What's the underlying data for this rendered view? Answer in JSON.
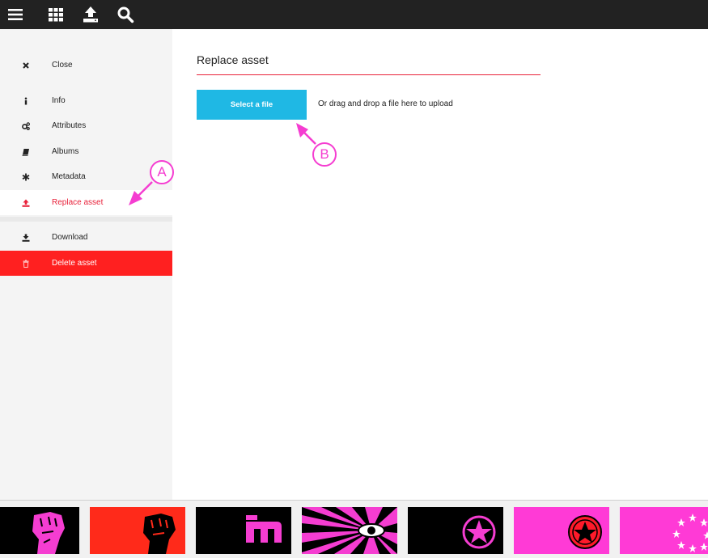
{
  "topbar": {
    "icons": [
      "menu-icon",
      "grid-icon",
      "upload-icon",
      "search-icon"
    ]
  },
  "sidebar": {
    "items": [
      {
        "id": "close",
        "label": "Close",
        "icon": "close-icon"
      },
      {
        "id": "info",
        "label": "Info",
        "icon": "info-icon"
      },
      {
        "id": "attributes",
        "label": "Attributes",
        "icon": "gears-icon"
      },
      {
        "id": "albums",
        "label": "Albums",
        "icon": "book-icon"
      },
      {
        "id": "metadata",
        "label": "Metadata",
        "icon": "asterisk-icon"
      },
      {
        "id": "replace",
        "label": "Replace asset",
        "icon": "upload-icon",
        "active": true
      },
      {
        "id": "download",
        "label": "Download",
        "icon": "download-icon"
      },
      {
        "id": "delete",
        "label": "Delete asset",
        "icon": "trash-icon",
        "danger": true
      }
    ]
  },
  "panel": {
    "title": "Replace asset",
    "select_label": "Select a file",
    "drop_hint": "Or drag and drop a file here to upload"
  },
  "annotations": {
    "a": "A",
    "b": "B"
  },
  "thumbnails": [
    {
      "name": "fist-pink-on-black",
      "icon": "fist-icon"
    },
    {
      "name": "fist-black-on-red",
      "icon": "fist-icon"
    },
    {
      "name": "letter-m-pink-on-black",
      "icon": "letter-m-icon"
    },
    {
      "name": "eye-sunburst",
      "icon": "eye-icon"
    },
    {
      "name": "star-circle-pink-on-black",
      "icon": "star-icon"
    },
    {
      "name": "star-circle-red-on-pink",
      "icon": "star-icon"
    },
    {
      "name": "stars-ring-on-pink",
      "icon": "stars-icon"
    }
  ],
  "colors": {
    "topbar": "#222222",
    "accent_red": "#e8213a",
    "danger": "#ff2020",
    "button_blue": "#1fb8e4",
    "annotation_pink": "#f53dd1"
  }
}
